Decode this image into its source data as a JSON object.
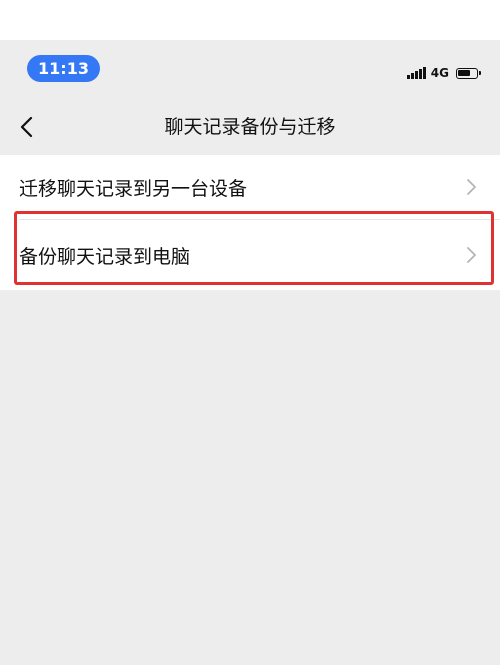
{
  "status_bar": {
    "time": "11:13",
    "network": "4G",
    "signal_icon": "signal-bars-icon",
    "battery_icon": "battery-icon"
  },
  "nav": {
    "back_icon": "chevron-left-icon",
    "title": "聊天记录备份与迁移"
  },
  "list": {
    "items": [
      {
        "label": "迁移聊天记录到另一台设备",
        "icon": "chevron-right-icon"
      },
      {
        "label": "备份聊天记录到电脑",
        "icon": "chevron-right-icon"
      }
    ]
  },
  "colors": {
    "accent": "#3478f6",
    "highlight": "#e03232",
    "background": "#ededee"
  }
}
